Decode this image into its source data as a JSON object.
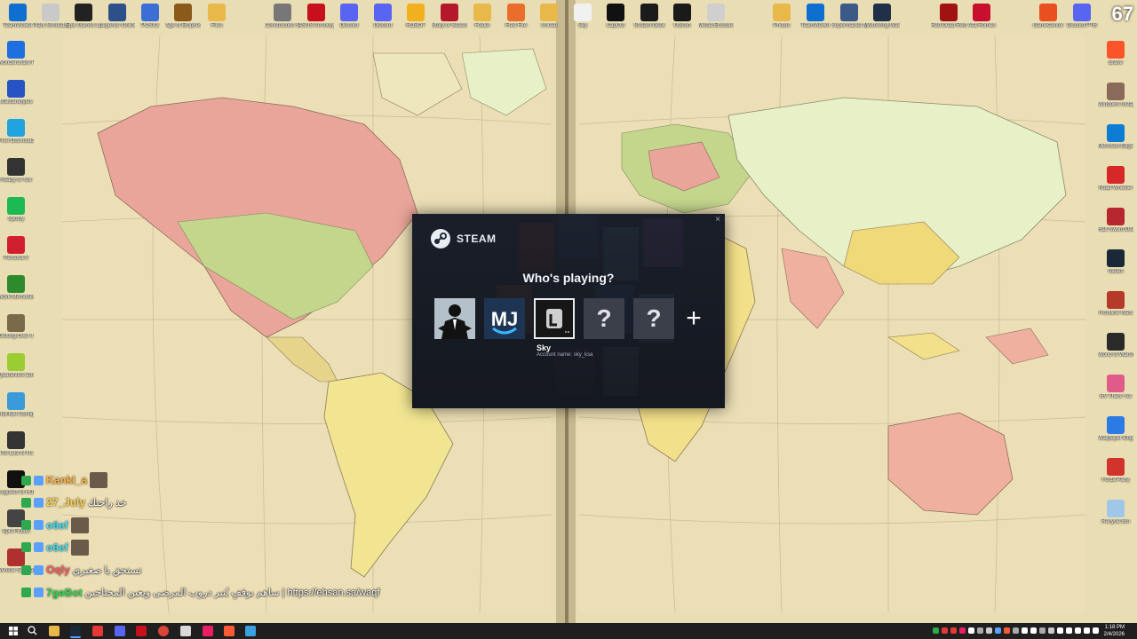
{
  "desktop": {
    "top_icons": [
      {
        "label": "TeamViewer",
        "color": "#0e6fd1"
      },
      {
        "label": "Plant Simulator",
        "color": "#c9c9c9"
      },
      {
        "label": "Epic Games Launcher",
        "color": "#222222"
      },
      {
        "label": "Legends Online",
        "color": "#2d4f8a"
      },
      {
        "label": "PCSX2",
        "color": "#3b6fd6"
      },
      {
        "label": "Age of Empires",
        "color": "#8a5a1a"
      },
      {
        "label": "Files",
        "color": "#e8b84a"
      },
      {
        "label": "Construction Simulator",
        "color": "#777777"
      },
      {
        "label": "ASUS Armoury",
        "color": "#c7101b"
      },
      {
        "label": "Discord",
        "color": "#5865f2"
      },
      {
        "label": "Discord",
        "color": "#5865f2"
      },
      {
        "label": "ROBOT",
        "color": "#f2b01e"
      },
      {
        "label": "Story of Seasons",
        "color": "#b3192b"
      },
      {
        "label": "Folder",
        "color": "#e8b84a"
      },
      {
        "label": "Free Fire",
        "color": "#ea6d2b"
      },
      {
        "label": "Unreal",
        "color": "#e8b84a"
      },
      {
        "label": "Sky",
        "color": "#f1f1f1"
      },
      {
        "label": "CapCut",
        "color": "#111111"
      },
      {
        "label": "Stream Deck",
        "color": "#1b1b1b"
      },
      {
        "label": "Ubisoft",
        "color": "#1a1a1a"
      },
      {
        "label": "Media Encoder",
        "color": "#cfcfcf"
      },
      {
        "label": "Photos",
        "color": "#e8b84a"
      },
      {
        "label": "TeamViewer",
        "color": "#0e6fd1"
      },
      {
        "label": "Supermarket Simulator",
        "color": "#3c5a87"
      },
      {
        "label": "Wuthering Waves",
        "color": "#203048"
      },
      {
        "label": "Red Dead Redemption 2",
        "color": "#a11212"
      },
      {
        "label": "Alfa Romeo",
        "color": "#c8102e"
      },
      {
        "label": "GameCenter",
        "color": "#e9501f"
      },
      {
        "label": "Discord PTB",
        "color": "#5865f2"
      }
    ],
    "left_icons": [
      {
        "label": "Wondershare PDFelement",
        "color": "#1e6fe0"
      },
      {
        "label": "Malwarebytes",
        "color": "#2654c4"
      },
      {
        "label": "Free Download",
        "color": "#1fa4e0"
      },
      {
        "label": "Ready or Not",
        "color": "#333333"
      },
      {
        "label": "Spotify",
        "color": "#1db954"
      },
      {
        "label": "Persona 5",
        "color": "#d21f2e"
      },
      {
        "label": "Work Memories",
        "color": "#2d8a2d"
      },
      {
        "label": "Getting Over It",
        "color": "#7a6a4a"
      },
      {
        "label": "Quarantine Zone",
        "color": "#9acd32"
      },
      {
        "label": "HidHide Configuration",
        "color": "#3a9ad9"
      },
      {
        "label": "The Last of Us",
        "color": "#333333"
      },
      {
        "label": "Logitech G HUB",
        "color": "#111111"
      },
      {
        "label": "Split Fiction",
        "color": "#444444"
      },
      {
        "label": "Vehicle Simulator",
        "color": "#b03030"
      }
    ],
    "right_icons": [
      {
        "label": "Brave",
        "color": "#fb542b"
      },
      {
        "label": "Windows Install",
        "color": "#8a6b5a"
      },
      {
        "label": "Microsoft Edge",
        "color": "#0c7cd5"
      },
      {
        "label": "Road Wheeler",
        "color": "#d62828"
      },
      {
        "label": "Half Sword Demo",
        "color": "#b7282e"
      },
      {
        "label": "Steam",
        "color": "#1b2838"
      },
      {
        "label": "Frontline Wars",
        "color": "#b53a2a"
      },
      {
        "label": "World of Warships",
        "color": "#2a2a2a"
      },
      {
        "label": "RV There Yet",
        "color": "#e15b8a"
      },
      {
        "label": "Wallpaper Engine",
        "color": "#2a7be4"
      },
      {
        "label": "Forza Party",
        "color": "#d0342c"
      },
      {
        "label": "Recycle Bin",
        "color": "#9ec7e8"
      }
    ]
  },
  "steam_dialog": {
    "brand": "STEAM",
    "close_icon": "×",
    "heading": "Who's playing?",
    "accounts": [
      {
        "id": "suit",
        "kind": "avatar"
      },
      {
        "id": "mj",
        "kind": "avatar",
        "text": "MJ"
      },
      {
        "id": "sky",
        "kind": "avatar",
        "selected": true
      },
      {
        "id": "unknown1",
        "kind": "unknown",
        "text": "?"
      },
      {
        "id": "unknown2",
        "kind": "unknown",
        "text": "?"
      },
      {
        "id": "add",
        "kind": "add",
        "text": "+"
      }
    ],
    "selected_name": "Sky",
    "selected_account_line": "Account name: sky_ksa"
  },
  "chat": [
    {
      "user": "KankI_a",
      "user_color": "#ffb347",
      "message": "",
      "has_emote": true
    },
    {
      "user": "27_July",
      "user_color": "#ffd24a",
      "message": "خذ راحتك"
    },
    {
      "user": "o6ef",
      "user_color": "#3ce3ff",
      "message": "",
      "has_emote": true
    },
    {
      "user": "o6ef",
      "user_color": "#3ce3ff",
      "message": "",
      "has_emote": true
    },
    {
      "user": "Oqly",
      "user_color": "#ff5a5a",
      "message": "تستحق يا صغيري"
    },
    {
      "user": "7geBot",
      "user_color": "#2bd94e",
      "message": "ساهم بوقفٍ يُنير دروب المرضى ويعين المحتاجين | https://ehsan.sa/waqf"
    }
  ],
  "overlay": {
    "fps": "67"
  },
  "taskbar": {
    "time": "1:18 PM",
    "date": "2/4/2026"
  }
}
